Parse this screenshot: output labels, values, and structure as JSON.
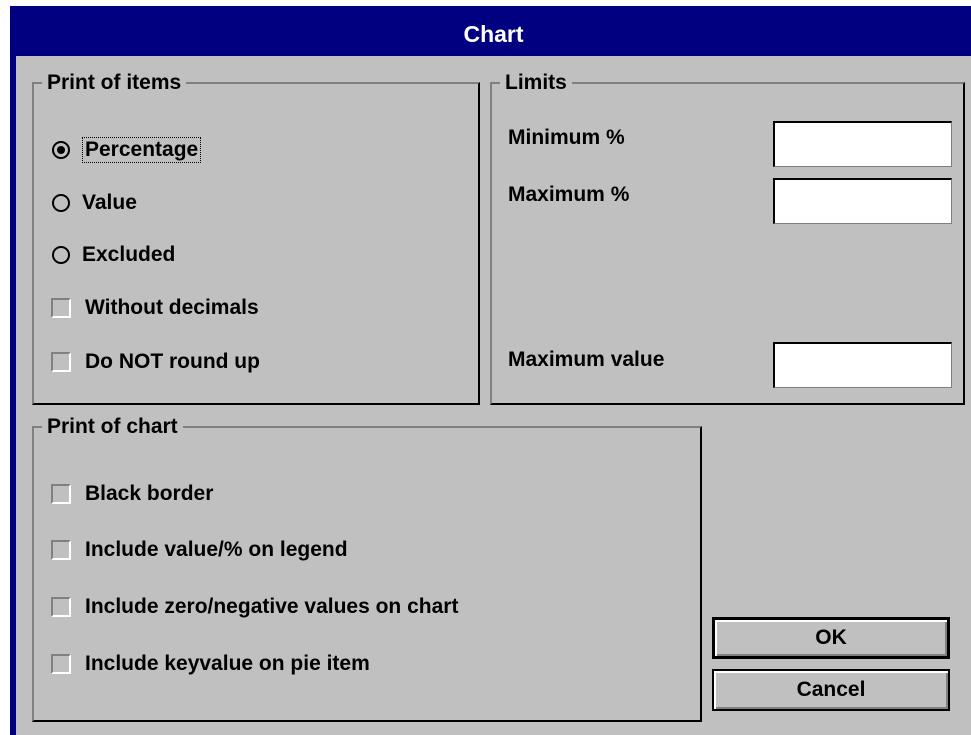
{
  "window": {
    "title": "Chart"
  },
  "print_of_items": {
    "title": "Print of items",
    "options": [
      {
        "label": "Percentage",
        "selected": true
      },
      {
        "label": "Value",
        "selected": false
      },
      {
        "label": "Excluded",
        "selected": false
      }
    ],
    "checkboxes": [
      {
        "label": "Without decimals",
        "checked": false
      },
      {
        "label": "Do NOT round up",
        "checked": false
      }
    ]
  },
  "limits": {
    "title": "Limits",
    "minimum_label": "Minimum %",
    "minimum_value": "",
    "maximum_label": "Maximum %",
    "maximum_value": "",
    "max_value_label": "Maximum value",
    "max_value_value": ""
  },
  "print_of_chart": {
    "title": "Print of chart",
    "checkboxes": [
      {
        "label": "Black border",
        "checked": false
      },
      {
        "label": "Include value/% on legend",
        "checked": false
      },
      {
        "label": "Include zero/negative values on chart",
        "checked": false
      },
      {
        "label": "Include keyvalue on pie item",
        "checked": false
      }
    ]
  },
  "buttons": {
    "ok": "OK",
    "cancel": "Cancel"
  }
}
